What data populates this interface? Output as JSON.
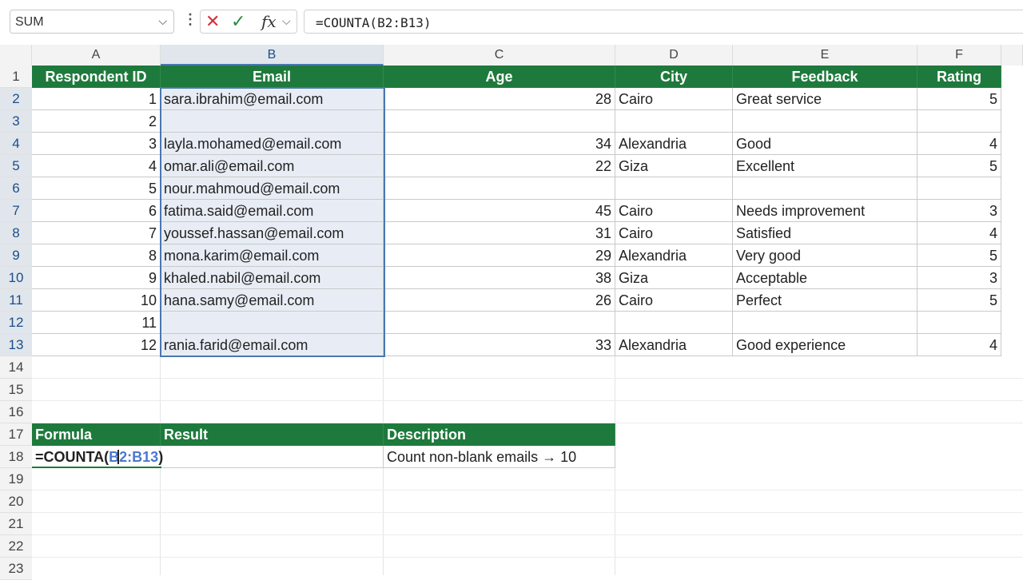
{
  "formula_bar": {
    "name_box": "SUM",
    "formula_text": "=COUNTA(B2:B13)",
    "fx_label": "fx"
  },
  "columns": [
    "A",
    "B",
    "C",
    "D",
    "E",
    "F"
  ],
  "rows": [
    "1",
    "2",
    "3",
    "4",
    "5",
    "6",
    "7",
    "8",
    "9",
    "10",
    "11",
    "12",
    "13",
    "14",
    "15",
    "16",
    "17",
    "18",
    "19",
    "20",
    "21",
    "22",
    "23"
  ],
  "table": {
    "headers": [
      "Respondent ID",
      "Email",
      "Age",
      "City",
      "Feedback",
      "Rating"
    ],
    "rows": [
      [
        "1",
        "sara.ibrahim@email.com",
        "28",
        "Cairo",
        "Great service",
        "5"
      ],
      [
        "2",
        "",
        "",
        "",
        "",
        ""
      ],
      [
        "3",
        "layla.mohamed@email.com",
        "34",
        "Alexandria",
        "Good",
        "4"
      ],
      [
        "4",
        "omar.ali@email.com",
        "22",
        "Giza",
        "Excellent",
        "5"
      ],
      [
        "5",
        "nour.mahmoud@email.com",
        "",
        "",
        "",
        ""
      ],
      [
        "6",
        "fatima.said@email.com",
        "45",
        "Cairo",
        "Needs improvement",
        "3"
      ],
      [
        "7",
        "youssef.hassan@email.com",
        "31",
        "Cairo",
        "Satisfied",
        "4"
      ],
      [
        "8",
        "mona.karim@email.com",
        "29",
        "Alexandria",
        "Very good",
        "5"
      ],
      [
        "9",
        "khaled.nabil@email.com",
        "38",
        "Giza",
        "Acceptable",
        "3"
      ],
      [
        "10",
        "hana.samy@email.com",
        "26",
        "Cairo",
        "Perfect",
        "5"
      ],
      [
        "11",
        "",
        "",
        "",
        "",
        ""
      ],
      [
        "12",
        "rania.farid@email.com",
        "33",
        "Alexandria",
        "Good experience",
        "4"
      ]
    ]
  },
  "summary": {
    "headers": [
      "Formula",
      "Result",
      "Description"
    ],
    "formula_prefix": "=COUNTA(",
    "formula_ref": "B2:B13",
    "formula_suffix": ")",
    "description": "Count non-blank emails → 10"
  },
  "colors": {
    "header_green": "#1e7a3c",
    "selection_blue": "#4a78b0",
    "cancel_red": "#d13438",
    "enter_green": "#2e8b3e"
  }
}
